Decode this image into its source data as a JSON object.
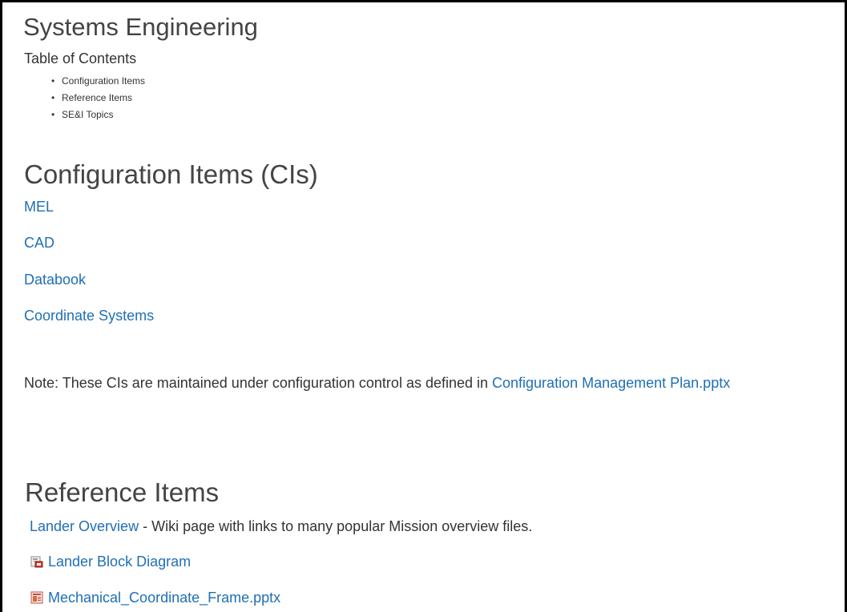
{
  "page": {
    "title": "Systems Engineering",
    "toc_title": "Table of Contents",
    "toc_items": [
      {
        "label": "Configuration Items"
      },
      {
        "label": "Reference Items"
      },
      {
        "label": "SE&I Topics"
      }
    ]
  },
  "config_items": {
    "heading": "Configuration Items (CIs)",
    "links": [
      {
        "label": "MEL"
      },
      {
        "label": "CAD"
      },
      {
        "label": "Databook"
      },
      {
        "label": "Coordinate Systems"
      }
    ],
    "note_prefix": "Note: These CIs are maintained under configuration control as defined in ",
    "note_link": "Configuration Management Plan.pptx"
  },
  "reference_items": {
    "heading": "Reference Items",
    "lander_overview_link": "Lander Overview",
    "lander_overview_desc": " - Wiki page with links to many popular Mission overview files.",
    "files": [
      {
        "label": "Lander Block Diagram",
        "icon": "diagram-file-icon"
      },
      {
        "label": "Mechanical_Coordinate_Frame.pptx",
        "icon": "powerpoint-file-icon"
      }
    ]
  },
  "colors": {
    "link": "#1f6fb5",
    "text": "#333333",
    "heading": "#444444",
    "border": "#000000"
  }
}
